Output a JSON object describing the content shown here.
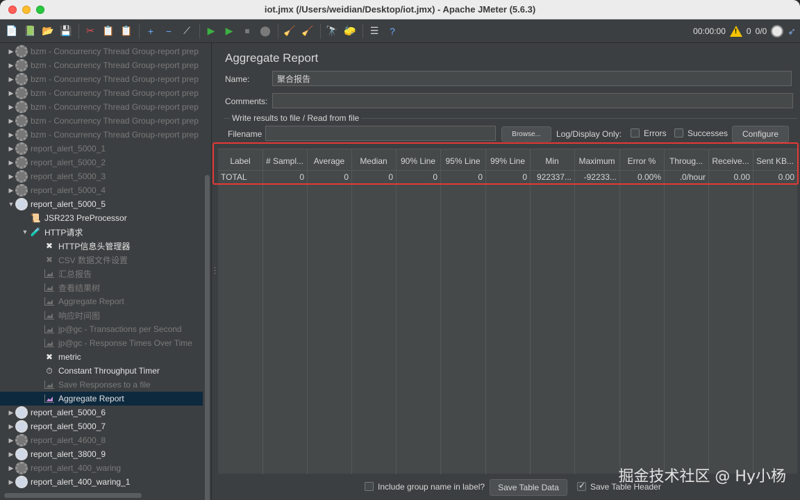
{
  "window": {
    "title": "iot.jmx (/Users/weidian/Desktop/iot.jmx) - Apache JMeter (5.6.3)"
  },
  "toolbar": {
    "icons": [
      "new-icon",
      "templates-icon",
      "open-icon",
      "save-icon",
      "cut-icon",
      "copy-icon",
      "paste-icon",
      "expand-icon",
      "collapse-icon",
      "toggle-icon",
      "start-icon",
      "start-no-pause-icon",
      "stop-icon",
      "shutdown-icon",
      "clear-icon",
      "clear-all-icon",
      "search-icon",
      "reset-search-icon",
      "function-helper-icon",
      "help-icon"
    ],
    "timer": "00:00:00",
    "warnings": "0",
    "threads": "0/0"
  },
  "tree": {
    "items": [
      {
        "label": "bzm - Concurrency Thread Group-report prep",
        "level": 0,
        "enabled": false,
        "icon": "gear",
        "arrow": "▶"
      },
      {
        "label": "bzm - Concurrency Thread Group-report prep",
        "level": 0,
        "enabled": false,
        "icon": "gear",
        "arrow": "▶"
      },
      {
        "label": "bzm - Concurrency Thread Group-report prep",
        "level": 0,
        "enabled": false,
        "icon": "gear",
        "arrow": "▶"
      },
      {
        "label": "bzm - Concurrency Thread Group-report prep",
        "level": 0,
        "enabled": false,
        "icon": "gear",
        "arrow": "▶"
      },
      {
        "label": "bzm - Concurrency Thread Group-report prep",
        "level": 0,
        "enabled": false,
        "icon": "gear",
        "arrow": "▶"
      },
      {
        "label": "bzm - Concurrency Thread Group-report prep",
        "level": 0,
        "enabled": false,
        "icon": "gear",
        "arrow": "▶"
      },
      {
        "label": "bzm - Concurrency Thread Group-report prep",
        "level": 0,
        "enabled": false,
        "icon": "gear",
        "arrow": "▶"
      },
      {
        "label": "report_alert_5000_1",
        "level": 0,
        "enabled": false,
        "icon": "gear",
        "arrow": "▶"
      },
      {
        "label": "report_alert_5000_2",
        "level": 0,
        "enabled": false,
        "icon": "gear",
        "arrow": "▶"
      },
      {
        "label": "report_alert_5000_3",
        "level": 0,
        "enabled": false,
        "icon": "gear",
        "arrow": "▶"
      },
      {
        "label": "report_alert_5000_4",
        "level": 0,
        "enabled": false,
        "icon": "gear",
        "arrow": "▶"
      },
      {
        "label": "report_alert_5000_5",
        "level": 0,
        "enabled": true,
        "icon": "gear",
        "arrow": "▼"
      },
      {
        "label": "JSR223 PreProcessor",
        "level": 1,
        "enabled": true,
        "icon": "script",
        "arrow": ""
      },
      {
        "label": "HTTP请求",
        "level": 1,
        "enabled": true,
        "icon": "pipette",
        "arrow": "▼"
      },
      {
        "label": "HTTP信息头管理器",
        "level": 2,
        "enabled": true,
        "icon": "tools",
        "arrow": ""
      },
      {
        "label": "CSV 数据文件设置",
        "level": 2,
        "enabled": false,
        "icon": "tools",
        "arrow": ""
      },
      {
        "label": "汇总报告",
        "level": 2,
        "enabled": false,
        "icon": "graph",
        "arrow": ""
      },
      {
        "label": "查看结果树",
        "level": 2,
        "enabled": false,
        "icon": "graph",
        "arrow": ""
      },
      {
        "label": "Aggregate Report",
        "level": 2,
        "enabled": false,
        "icon": "graph",
        "arrow": ""
      },
      {
        "label": "响应时间图",
        "level": 2,
        "enabled": false,
        "icon": "graph",
        "arrow": ""
      },
      {
        "label": "jp@gc - Transactions per Second",
        "level": 2,
        "enabled": false,
        "icon": "graph",
        "arrow": ""
      },
      {
        "label": "jp@gc - Response Times Over Time",
        "level": 2,
        "enabled": false,
        "icon": "graph",
        "arrow": ""
      },
      {
        "label": "metric",
        "level": 2,
        "enabled": true,
        "icon": "tools",
        "arrow": ""
      },
      {
        "label": "Constant Throughput Timer",
        "level": 2,
        "enabled": true,
        "icon": "timer",
        "arrow": ""
      },
      {
        "label": "Save Responses to a file",
        "level": 2,
        "enabled": false,
        "icon": "graph",
        "arrow": ""
      },
      {
        "label": "Aggregate Report",
        "level": 2,
        "enabled": true,
        "icon": "graph",
        "arrow": "",
        "selected": true
      },
      {
        "label": "report_alert_5000_6",
        "level": 0,
        "enabled": true,
        "icon": "gear",
        "arrow": "▶"
      },
      {
        "label": "report_alert_5000_7",
        "level": 0,
        "enabled": true,
        "icon": "gear",
        "arrow": "▶"
      },
      {
        "label": "report_alert_4600_8",
        "level": 0,
        "enabled": false,
        "icon": "gear",
        "arrow": "▶"
      },
      {
        "label": "report_alert_3800_9",
        "level": 0,
        "enabled": true,
        "icon": "gear",
        "arrow": "▶"
      },
      {
        "label": "report_alert_400_waring",
        "level": 0,
        "enabled": false,
        "icon": "gear",
        "arrow": "▶"
      },
      {
        "label": "report_alert_400_waring_1",
        "level": 0,
        "enabled": true,
        "icon": "gear",
        "arrow": "▶"
      }
    ]
  },
  "panel": {
    "title": "Aggregate Report",
    "name_label": "Name:",
    "name_value": "聚合报告",
    "comments_label": "Comments:",
    "comments_value": "",
    "file_legend": "Write results to file / Read from file",
    "filename_label": "Filename",
    "filename_value": "",
    "browse_label": "Browse...",
    "log_display_label": "Log/Display Only:",
    "errors_label": "Errors",
    "successes_label": "Successes",
    "configure_label": "Configure"
  },
  "table": {
    "columns": [
      "Label",
      "# Sampl...",
      "Average",
      "Median",
      "90% Line",
      "95% Line",
      "99% Line",
      "Min",
      "Maximum",
      "Error %",
      "Throug...",
      "Receive...",
      "Sent KB..."
    ],
    "rows": [
      [
        "TOTAL",
        "0",
        "0",
        "0",
        "0",
        "0",
        "0",
        "922337...",
        "-92233...",
        "0.00%",
        ".0/hour",
        "0.00",
        "0.00"
      ]
    ]
  },
  "footer": {
    "include_group_label": "Include group name in label?",
    "save_table_data_label": "Save Table Data",
    "save_table_header_label": "Save Table Header",
    "save_table_header_checked": true
  },
  "watermark": "掘金技术社区 @ Hy小杨"
}
